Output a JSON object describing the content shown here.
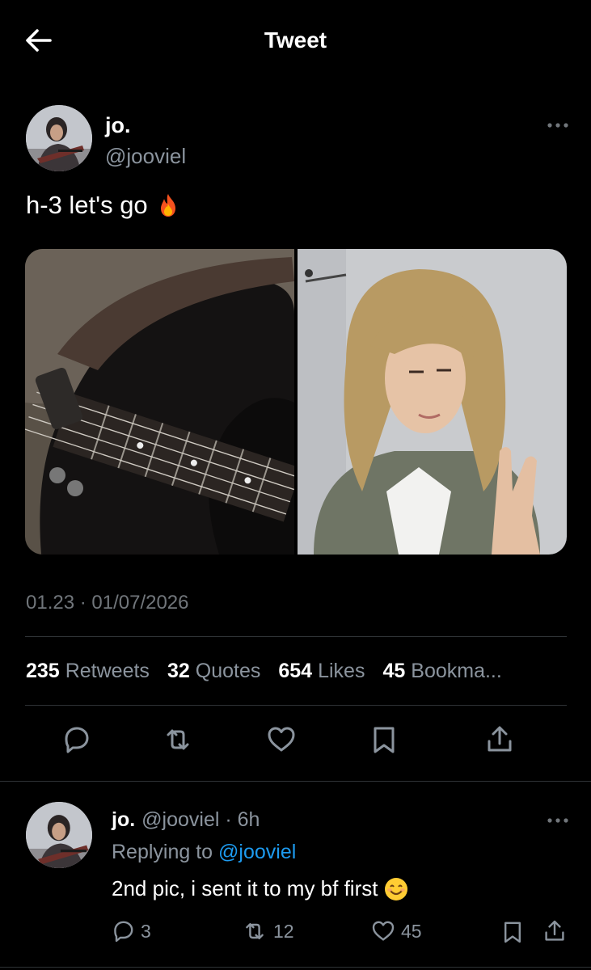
{
  "header": {
    "title": "Tweet",
    "back_icon": "arrow-left-icon"
  },
  "tweet": {
    "display_name": "jo.",
    "handle": "@jooviel",
    "text": "h-3 let's go",
    "emoji": "fire-icon",
    "timestamp": "01.23 · 01/07/2026",
    "media": [
      {
        "name": "guitar-photo"
      },
      {
        "name": "selfie-photo"
      }
    ],
    "stats": [
      {
        "num": "235",
        "label": "Retweets"
      },
      {
        "num": "32",
        "label": "Quotes"
      },
      {
        "num": "654",
        "label": "Likes"
      },
      {
        "num": "45",
        "label": "Bookma..."
      }
    ],
    "actions": [
      "reply-icon",
      "retweet-icon",
      "like-icon",
      "bookmark-icon",
      "share-icon"
    ]
  },
  "reply": {
    "display_name": "jo.",
    "meta": "@jooviel · 6h",
    "replying_prefix": "Replying to",
    "replying_to": "@jooviel",
    "text": "2nd pic, i sent it to my bf first",
    "emoji": "smiling-face-icon",
    "counts": {
      "replies": "3",
      "retweets": "12",
      "likes": "45"
    }
  },
  "colors": {
    "background": "#000000",
    "text": "#e7e9ea",
    "muted": "#8b949e",
    "accent": "#1d9bf0",
    "divider": "#2f3336"
  }
}
